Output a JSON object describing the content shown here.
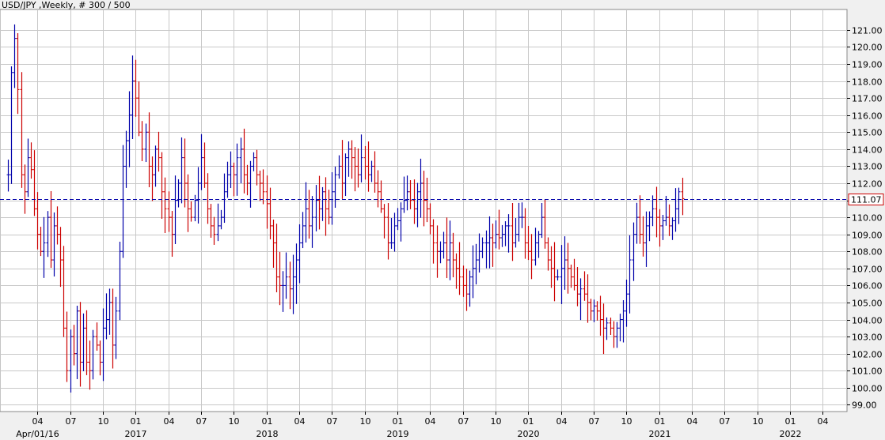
{
  "chart_data": {
    "type": "ohlc",
    "title": "USD/JPY ,Weekly, # 300 / 500",
    "last_price_label": "111.07",
    "last_price": 111.07,
    "ylim": [
      98.6,
      122.2
    ],
    "y_ticks": [
      99.0,
      100.0,
      101.0,
      102.0,
      103.0,
      104.0,
      105.0,
      106.0,
      107.0,
      108.0,
      109.0,
      110.0,
      111.0,
      112.0,
      113.0,
      114.0,
      115.0,
      116.0,
      117.0,
      118.0,
      119.0,
      120.0,
      121.0
    ],
    "y_tick_labels": [
      "99.00",
      "100.00",
      "101.00",
      "102.00",
      "103.00",
      "104.00",
      "105.00",
      "106.00",
      "107.00",
      "108.00",
      "109.00",
      "110.00",
      "111.00",
      "112.00",
      "113.00",
      "114.00",
      "115.00",
      "116.00",
      "117.00",
      "118.00",
      "119.00",
      "120.00",
      "121.00"
    ],
    "x_ticks": [
      {
        "label": "04",
        "sub": "Apr/01/16",
        "week": 9
      },
      {
        "label": "07",
        "sub": "",
        "week": 19
      },
      {
        "label": "10",
        "sub": "",
        "week": 29
      },
      {
        "label": "01",
        "sub": "2017",
        "week": 39
      },
      {
        "label": "04",
        "sub": "",
        "week": 49
      },
      {
        "label": "07",
        "sub": "",
        "week": 59
      },
      {
        "label": "10",
        "sub": "",
        "week": 69
      },
      {
        "label": "01",
        "sub": "2018",
        "week": 79
      },
      {
        "label": "04",
        "sub": "",
        "week": 89
      },
      {
        "label": "07",
        "sub": "",
        "week": 99
      },
      {
        "label": "10",
        "sub": "",
        "week": 109
      },
      {
        "label": "01",
        "sub": "2019",
        "week": 119
      },
      {
        "label": "04",
        "sub": "",
        "week": 129
      },
      {
        "label": "07",
        "sub": "",
        "week": 139
      },
      {
        "label": "10",
        "sub": "",
        "week": 149
      },
      {
        "label": "01",
        "sub": "2020",
        "week": 159
      },
      {
        "label": "04",
        "sub": "",
        "week": 169
      },
      {
        "label": "07",
        "sub": "",
        "week": 179
      },
      {
        "label": "10",
        "sub": "",
        "week": 189
      },
      {
        "label": "01",
        "sub": "2021",
        "week": 199
      },
      {
        "label": "04",
        "sub": "",
        "week": 209
      },
      {
        "label": "07",
        "sub": "",
        "week": 219
      },
      {
        "label": "10",
        "sub": "",
        "week": 229
      },
      {
        "label": "01",
        "sub": "2022",
        "week": 239
      },
      {
        "label": "04",
        "sub": "",
        "week": 249
      }
    ],
    "week_range": [
      0,
      254
    ],
    "grid": true,
    "colors": {
      "up": "#0000aa",
      "down": "#cc0000",
      "grid": "#c8c8c8",
      "last_line": "#0000aa",
      "last_box": "#cc0000"
    },
    "anchors": [
      [
        0,
        112.5
      ],
      [
        1,
        118.5
      ],
      [
        2,
        120.5
      ],
      [
        3,
        117.5
      ],
      [
        4,
        112.5
      ],
      [
        5,
        111.5
      ],
      [
        6,
        113.5
      ],
      [
        7,
        112.8
      ],
      [
        8,
        110.5
      ],
      [
        9,
        109.0
      ],
      [
        10,
        108.0
      ],
      [
        11,
        108.5
      ],
      [
        12,
        110.0
      ],
      [
        13,
        107.5
      ],
      [
        14,
        109.5
      ],
      [
        15,
        109.0
      ],
      [
        16,
        107.5
      ],
      [
        17,
        103.5
      ],
      [
        18,
        101.0
      ],
      [
        19,
        103.0
      ],
      [
        20,
        102.0
      ],
      [
        21,
        104.5
      ],
      [
        22,
        101.5
      ],
      [
        23,
        103.5
      ],
      [
        24,
        101.5
      ],
      [
        25,
        101.0
      ],
      [
        26,
        103.0
      ],
      [
        27,
        102.5
      ],
      [
        28,
        101.5
      ],
      [
        29,
        103.5
      ],
      [
        30,
        104.0
      ],
      [
        31,
        105.0
      ],
      [
        32,
        102.5
      ],
      [
        33,
        104.5
      ],
      [
        34,
        108.0
      ],
      [
        35,
        113.0
      ],
      [
        36,
        114.5
      ],
      [
        37,
        116.0
      ],
      [
        38,
        118.0
      ],
      [
        39,
        117.0
      ],
      [
        40,
        115.0
      ],
      [
        41,
        114.0
      ],
      [
        42,
        115.0
      ],
      [
        43,
        113.0
      ],
      [
        44,
        112.5
      ],
      [
        45,
        114.0
      ],
      [
        46,
        113.5
      ],
      [
        47,
        111.5
      ],
      [
        48,
        110.5
      ],
      [
        49,
        110.0
      ],
      [
        50,
        109.0
      ],
      [
        51,
        111.0
      ],
      [
        52,
        112.0
      ],
      [
        53,
        113.5
      ],
      [
        54,
        112.0
      ],
      [
        55,
        110.5
      ],
      [
        56,
        110.0
      ],
      [
        57,
        111.0
      ],
      [
        58,
        112.0
      ],
      [
        59,
        113.5
      ],
      [
        60,
        112.0
      ],
      [
        61,
        110.5
      ],
      [
        62,
        109.5
      ],
      [
        63,
        109.0
      ],
      [
        64,
        109.5
      ],
      [
        65,
        110.0
      ],
      [
        66,
        111.5
      ],
      [
        67,
        112.5
      ],
      [
        68,
        113.0
      ],
      [
        69,
        112.5
      ],
      [
        70,
        113.5
      ],
      [
        71,
        114.0
      ],
      [
        72,
        112.5
      ],
      [
        73,
        112.0
      ],
      [
        74,
        113.0
      ],
      [
        75,
        113.5
      ],
      [
        76,
        112.5
      ],
      [
        77,
        112.0
      ],
      [
        78,
        111.5
      ],
      [
        79,
        110.8
      ],
      [
        80,
        109.5
      ],
      [
        81,
        108.5
      ],
      [
        82,
        106.5
      ],
      [
        83,
        106.0
      ],
      [
        84,
        106.0
      ],
      [
        85,
        106.5
      ],
      [
        86,
        105.8
      ],
      [
        87,
        106.5
      ],
      [
        88,
        107.5
      ],
      [
        89,
        108.5
      ],
      [
        90,
        109.5
      ],
      [
        91,
        110.5
      ],
      [
        92,
        109.5
      ],
      [
        93,
        110.0
      ],
      [
        94,
        111.0
      ],
      [
        95,
        110.5
      ],
      [
        96,
        111.5
      ],
      [
        97,
        110.5
      ],
      [
        98,
        110.0
      ],
      [
        99,
        111.5
      ],
      [
        100,
        112.5
      ],
      [
        101,
        113.0
      ],
      [
        102,
        112.0
      ],
      [
        103,
        113.5
      ],
      [
        104,
        114.0
      ],
      [
        105,
        113.5
      ],
      [
        106,
        113.0
      ],
      [
        107,
        112.5
      ],
      [
        108,
        113.5
      ],
      [
        109,
        113.0
      ],
      [
        110,
        112.5
      ],
      [
        111,
        113.0
      ],
      [
        112,
        112.0
      ],
      [
        113,
        111.5
      ],
      [
        114,
        110.5
      ],
      [
        115,
        110.0
      ],
      [
        116,
        108.5
      ],
      [
        117,
        108.5
      ],
      [
        118,
        109.5
      ],
      [
        119,
        109.8
      ],
      [
        120,
        110.5
      ],
      [
        121,
        111.0
      ],
      [
        122,
        111.5
      ],
      [
        123,
        111.0
      ],
      [
        124,
        110.5
      ],
      [
        125,
        111.5
      ],
      [
        126,
        112.0
      ],
      [
        127,
        111.0
      ],
      [
        128,
        110.5
      ],
      [
        129,
        109.5
      ],
      [
        130,
        108.5
      ],
      [
        131,
        108.0
      ],
      [
        132,
        108.0
      ],
      [
        133,
        108.5
      ],
      [
        134,
        107.5
      ],
      [
        135,
        108.5
      ],
      [
        136,
        107.5
      ],
      [
        137,
        107.0
      ],
      [
        138,
        106.5
      ],
      [
        139,
        106.0
      ],
      [
        140,
        105.5
      ],
      [
        141,
        106.5
      ],
      [
        142,
        107.0
      ],
      [
        143,
        107.5
      ],
      [
        144,
        108.0
      ],
      [
        145,
        108.5
      ],
      [
        146,
        108.5
      ],
      [
        147,
        108.8
      ],
      [
        148,
        108.5
      ],
      [
        149,
        109.0
      ],
      [
        150,
        108.8
      ],
      [
        151,
        109.0
      ],
      [
        152,
        109.5
      ],
      [
        153,
        109.5
      ],
      [
        154,
        108.5
      ],
      [
        155,
        109.0
      ],
      [
        156,
        110.0
      ],
      [
        157,
        110.0
      ],
      [
        158,
        108.5
      ],
      [
        159,
        108.0
      ],
      [
        160,
        107.5
      ],
      [
        161,
        108.5
      ],
      [
        162,
        109.0
      ],
      [
        163,
        110.0
      ],
      [
        164,
        108.5
      ],
      [
        165,
        107.5
      ],
      [
        166,
        107.0
      ],
      [
        167,
        106.5
      ],
      [
        168,
        106.5
      ],
      [
        169,
        107.0
      ],
      [
        170,
        107.5
      ],
      [
        171,
        107.0
      ],
      [
        172,
        106.5
      ],
      [
        173,
        106.0
      ],
      [
        174,
        105.5
      ],
      [
        175,
        105.8
      ],
      [
        176,
        105.5
      ],
      [
        177,
        105.0
      ],
      [
        178,
        104.5
      ],
      [
        179,
        104.8
      ],
      [
        180,
        104.5
      ],
      [
        181,
        104.0
      ],
      [
        182,
        103.5
      ],
      [
        183,
        103.8
      ],
      [
        184,
        103.5
      ],
      [
        185,
        103.0
      ],
      [
        186,
        103.5
      ],
      [
        187,
        104.0
      ],
      [
        188,
        104.5
      ],
      [
        189,
        105.5
      ],
      [
        190,
        107.5
      ],
      [
        191,
        109.0
      ],
      [
        192,
        110.0
      ],
      [
        193,
        109.0
      ],
      [
        194,
        108.5
      ],
      [
        195,
        109.5
      ],
      [
        196,
        110.0
      ],
      [
        197,
        110.5
      ],
      [
        198,
        110.0
      ],
      [
        199,
        109.5
      ],
      [
        200,
        109.8
      ],
      [
        201,
        110.0
      ],
      [
        202,
        109.5
      ],
      [
        203,
        109.8
      ],
      [
        204,
        110.5
      ],
      [
        205,
        111.5
      ],
      [
        206,
        111.1
      ]
    ]
  }
}
